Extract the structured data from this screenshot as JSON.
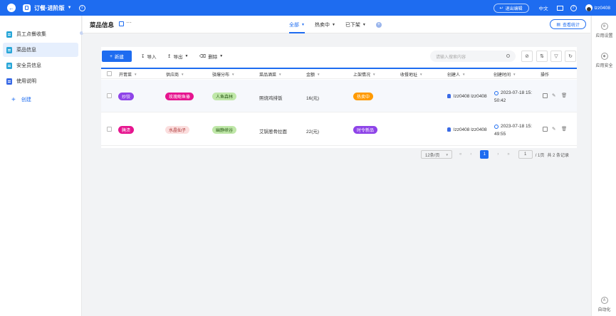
{
  "app": {
    "name": "订餐·进阶版",
    "exit_edit": "退出编辑",
    "language": "中文",
    "username": "lzz0408"
  },
  "sidebar": {
    "items": [
      {
        "label": "员工点餐收集"
      },
      {
        "label": "菜品信息"
      },
      {
        "label": "安全员信息"
      },
      {
        "label": "使用说明"
      }
    ],
    "add_label": "创建"
  },
  "header": {
    "title": "菜品信息",
    "tabs": [
      {
        "label": "全部"
      },
      {
        "label": "热卖中"
      },
      {
        "label": "已下架"
      }
    ],
    "stats_button": "查看统计"
  },
  "right_panel": {
    "items": [
      "应用设置",
      "应用安全",
      "自动化"
    ]
  },
  "toolbar": {
    "new": "新建",
    "import": "导入",
    "export": "导出",
    "delete": "删除",
    "search_placeholder": "请输入搜索内容"
  },
  "table": {
    "columns": [
      "开胃菜",
      "供应商",
      "驿爆分布",
      "菜品酒菜",
      "金额",
      "上架情况",
      "收餐地址",
      "创建人",
      "创建时间",
      "操作"
    ],
    "rows": [
      {
        "appetizer": "炒饺",
        "supplier": "玫瑰鲍鱼傣",
        "distribution": "人鱼森林",
        "dish": "照烧鸡排饭",
        "amount": "16(元)",
        "status": "热卖中",
        "creator": "lzz0408 lzz0408",
        "created_time_line1": "2023-07-18 15:",
        "created_time_line2": "50:42"
      },
      {
        "appetizer": "腌渍",
        "supplier": "水晶仙子",
        "distribution": "幽静峡谷",
        "dish": "艾锅葱骨拉面",
        "amount": "22(元)",
        "status": "时令新品",
        "creator": "lzz0408 lzz0408",
        "created_time_line1": "2023-07-18 15:",
        "created_time_line2": "49:55"
      }
    ]
  },
  "pagination": {
    "page_size": "12条/页",
    "current_page": "1",
    "jump_value": "1",
    "total_pages": "/ 1页",
    "total_records": "共 2 条记录"
  },
  "colors": {
    "primary": "#1e6cf0",
    "tag_purple": "#8e44e8",
    "tag_magenta": "#e6158f",
    "tag_pink_bg": "#fbdede",
    "tag_green_bg": "#bfe7a8",
    "tag_orange": "#ff9a00"
  }
}
